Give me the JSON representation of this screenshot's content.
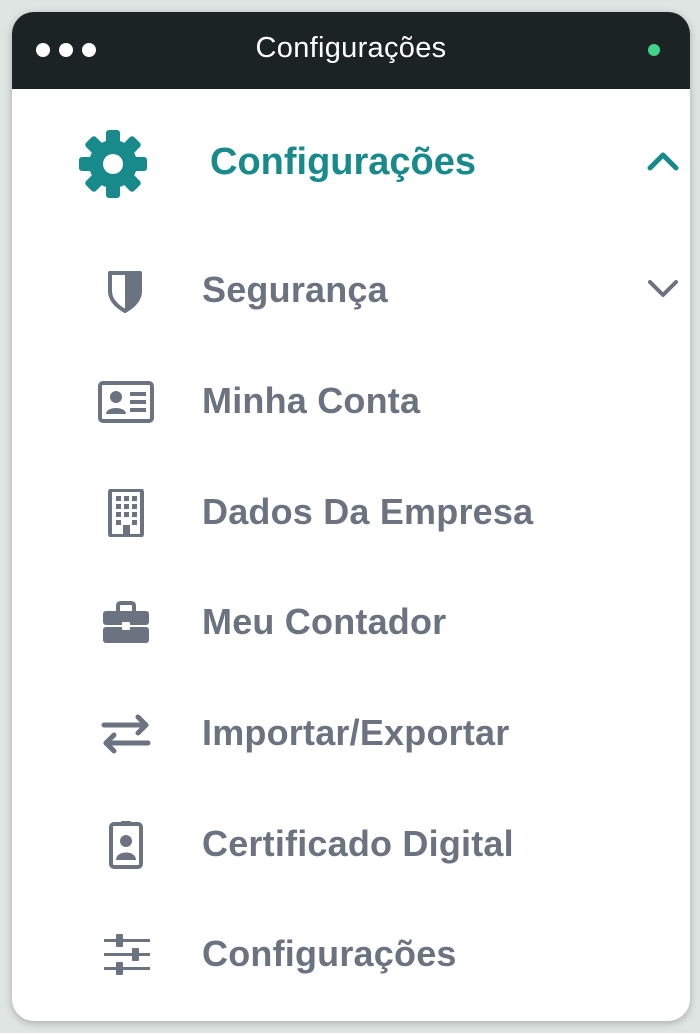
{
  "window": {
    "title": "Configurações"
  },
  "menu": {
    "header": {
      "label": "Configurações",
      "icon": "gear-icon",
      "expanded": true
    },
    "items": [
      {
        "label": "Segurança",
        "icon": "shield-icon",
        "has_submenu": true
      },
      {
        "label": "Minha Conta",
        "icon": "id-card-icon"
      },
      {
        "label": "Dados Da Empresa",
        "icon": "building-icon"
      },
      {
        "label": "Meu Contador",
        "icon": "briefcase-icon"
      },
      {
        "label": "Importar/Exportar",
        "icon": "exchange-arrows-icon"
      },
      {
        "label": "Certificado Digital",
        "icon": "badge-icon"
      },
      {
        "label": "Configurações",
        "icon": "sliders-icon"
      }
    ]
  },
  "colors": {
    "accent": "#188a8c",
    "text": "#6b7280",
    "titlebar": "#1b2324",
    "status": "#3fd38b"
  }
}
